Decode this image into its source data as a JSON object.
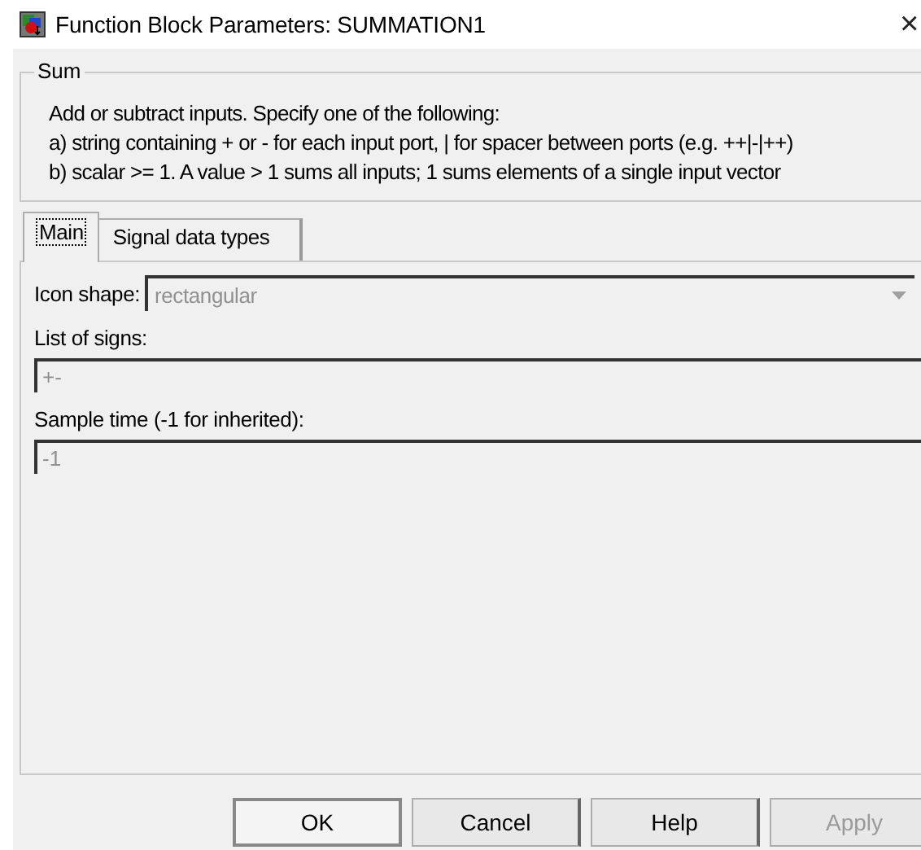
{
  "window": {
    "title": "Function Block Parameters: SUMMATION1",
    "close": "×"
  },
  "group": {
    "title": "Sum",
    "lines": [
      "Add or subtract inputs.  Specify one of the following:",
      "a) string containing + or - for each input port, | for spacer between ports (e.g. ++|-|++)",
      "b) scalar >= 1. A value > 1 sums all inputs; 1 sums elements of a single input vector"
    ]
  },
  "tabs": [
    {
      "label": "Main",
      "selected": true
    },
    {
      "label": "Signal data types",
      "selected": false
    }
  ],
  "params": [
    {
      "kind": "dropdown",
      "label": "Icon shape:",
      "value": "rectangular",
      "disabled": true
    },
    {
      "kind": "text",
      "label": "List of signs:",
      "value": "+-",
      "disabled": true
    },
    {
      "kind": "text",
      "label": "Sample time (-1 for inherited):",
      "value": "-1",
      "disabled": true
    }
  ],
  "buttons": [
    {
      "label": "OK",
      "default": true,
      "disabled": false
    },
    {
      "label": "Cancel",
      "default": false,
      "disabled": false
    },
    {
      "label": "Help",
      "default": false,
      "disabled": false
    },
    {
      "label": "Apply",
      "default": false,
      "disabled": true
    }
  ]
}
